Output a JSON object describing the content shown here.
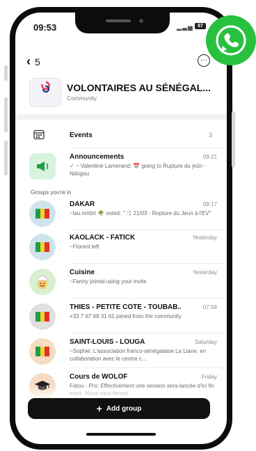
{
  "status": {
    "time": "09:53",
    "battery": "87"
  },
  "nav": {
    "back_label": "‹",
    "back_count": "5"
  },
  "community": {
    "name": "VOLONTAIRES AU SÉNÉGAL...",
    "subtitle": "Community",
    "logo_text": "france volontaires"
  },
  "events": {
    "label": "Events",
    "count": "3"
  },
  "announcements": {
    "title": "Announcements",
    "time": "09:21",
    "preview": "✓ ~ Valentine Lamerand: 📅 going to Rupture du jeûn - Ndogou"
  },
  "groups_label": "Groups you're in",
  "groups": [
    {
      "title": "DAKAR",
      "time": "09:17",
      "preview": "~lau.nmbrt 🌴 voted: \"📑 21/03 - Rupture du Jeun à l'EV\"",
      "avatar": "flag"
    },
    {
      "title": "KAOLACK - FATICK",
      "time": "Yesterday",
      "preview": "~Florent left",
      "avatar": "flag"
    },
    {
      "title": "Cuisine",
      "time": "Yesterday",
      "preview": "~Fanny joined using your invite",
      "avatar": "chef"
    },
    {
      "title": "THIES - PETITE CÔTE - TOUBAB...",
      "time": "07:58",
      "preview": "+33 7 67 69 31 61 joined from the community",
      "avatar": "flag"
    },
    {
      "title": "SAINT-LOUIS - LOUGA",
      "time": "Saturday",
      "preview": "~Sophie: L'association franco-sénégalaise La Liane, en collaboration avec le centre c...",
      "avatar": "flag"
    },
    {
      "title": "Cours de WOLOF",
      "time": "Friday",
      "preview": "Fatou - Pro: Effectivement une session sera lancée d'ici fin mars. Nous vous ferons",
      "avatar": "grad"
    }
  ],
  "add_group": {
    "label": "Add group",
    "plus": "+"
  },
  "colors": {
    "whatsapp": "#28c13f",
    "flag_green": "#1f9d49",
    "flag_yellow": "#f3d22b",
    "flag_red": "#e0322b",
    "avatar_bg_blue": "#cfe3ec",
    "avatar_bg_peach": "#f6dcc3",
    "avatar_bg_gray": "#e0e0e0"
  }
}
